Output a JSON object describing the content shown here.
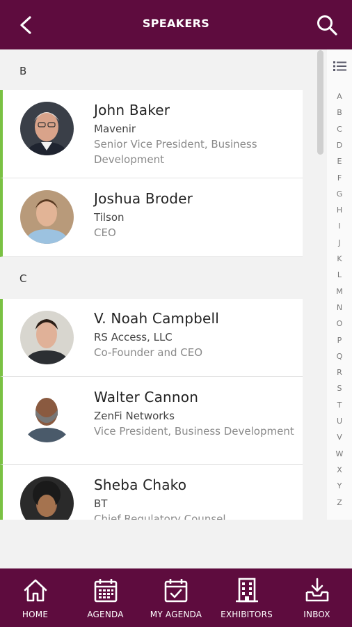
{
  "header": {
    "title": "SPEAKERS"
  },
  "sections": [
    {
      "letter": "B",
      "speakers": [
        {
          "name": "John Baker",
          "company": "Mavenir",
          "role": "Senior Vice President, Business Development"
        },
        {
          "name": "Joshua Broder",
          "company": "Tilson",
          "role": "CEO"
        }
      ]
    },
    {
      "letter": "C",
      "speakers": [
        {
          "name": "V. Noah Campbell",
          "company": "RS Access, LLC",
          "role": "Co-Founder and CEO"
        },
        {
          "name": "Walter Cannon",
          "company": "ZenFi Networks",
          "role": "Vice President, Business Development"
        },
        {
          "name": "Sheba Chako",
          "company": "BT",
          "role": "Chief Regulatory Counsel"
        }
      ]
    }
  ],
  "index_letters": [
    "A",
    "B",
    "C",
    "D",
    "E",
    "F",
    "G",
    "H",
    "I",
    "J",
    "K",
    "L",
    "M",
    "N",
    "O",
    "P",
    "Q",
    "R",
    "S",
    "T",
    "U",
    "V",
    "W",
    "X",
    "Y",
    "Z"
  ],
  "tabs": [
    {
      "label": "HOME",
      "icon": "home-icon"
    },
    {
      "label": "AGENDA",
      "icon": "calendar-icon"
    },
    {
      "label": "MY AGENDA",
      "icon": "calendar-check-icon"
    },
    {
      "label": "EXHIBITORS",
      "icon": "building-icon"
    },
    {
      "label": "INBOX",
      "icon": "inbox-download-icon"
    }
  ],
  "colors": {
    "brand": "#5e0c3e",
    "accent": "#7ac143"
  }
}
